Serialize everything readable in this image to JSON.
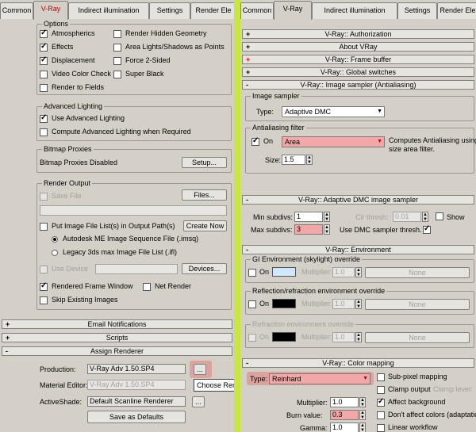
{
  "left": {
    "tabs": [
      "Common",
      "V-Ray",
      "Indirect illumination",
      "Settings",
      "Render Ele"
    ],
    "options_title": "Options",
    "options": [
      {
        "label": "Atmospherics",
        "checked": true
      },
      {
        "label": "Effects",
        "checked": true
      },
      {
        "label": "Displacement",
        "checked": true
      },
      {
        "label": "Video Color Check",
        "checked": false
      },
      {
        "label": "Render to Fields",
        "checked": false
      },
      {
        "label": "Render Hidden Geometry",
        "checked": false
      },
      {
        "label": "Area Lights/Shadows as Points",
        "checked": false
      },
      {
        "label": "Force 2-Sided",
        "checked": false
      },
      {
        "label": "Super Black",
        "checked": false
      }
    ],
    "advanced_lighting": {
      "title": "Advanced Lighting",
      "use": "Use Advanced Lighting",
      "compute": "Compute Advanced Lighting when Required"
    },
    "bitmap_proxies": {
      "title": "Bitmap Proxies",
      "status": "Bitmap Proxies Disabled",
      "setup": "Setup..."
    },
    "render_output": {
      "title": "Render Output",
      "save_file": "Save File",
      "files": "Files...",
      "put_image": "Put Image File List(s) in Output Path(s)",
      "create_now": "Create Now",
      "radio1": "Autodesk ME Image Sequence File (.imsq)",
      "radio2": "Legacy 3ds max Image File List (.ifl)",
      "use_device": "Use Device",
      "devices": "Devices...",
      "rendered_frame": "Rendered Frame Window",
      "net_render": "Net Render",
      "skip_existing": "Skip Existing Images"
    },
    "rollouts": [
      "Email Notifications",
      "Scripts",
      "Assign Renderer"
    ],
    "assign": {
      "production_label": "Production:",
      "production_value": "V-Ray Adv 1.50.SP4",
      "material_label": "Material Editor:",
      "material_value": "V-Ray Adv 1.50.SP4",
      "activeshade_label": "ActiveShade:",
      "activeshade_value": "Default Scanline Renderer",
      "choose_tip": "Choose Ren",
      "save_defaults": "Save as Defaults",
      "ellipsis": "..."
    }
  },
  "right": {
    "tabs": [
      "Common",
      "V-Ray",
      "Indirect illumination",
      "Settings",
      "Render Ele"
    ],
    "rollouts": [
      "V-Ray:: Authorization",
      "About VRay",
      "V-Ray:: Frame buffer",
      "V-Ray:: Global switches",
      "V-Ray:: Image sampler (Antialiasing)"
    ],
    "image_sampler": {
      "title": "Image sampler",
      "type_label": "Type:",
      "type_value": "Adaptive DMC"
    },
    "aa_filter": {
      "title": "Antialiasing filter",
      "on_label": "On",
      "filter_value": "Area",
      "desc1": "Computes Antialiasing using",
      "desc2": "size area filter.",
      "size_label": "Size:",
      "size_value": "1.5"
    },
    "dmc": {
      "title": "V-Ray:: Adaptive DMC image sampler",
      "min_label": "Min subdivs:",
      "min_value": "1",
      "max_label": "Max subdivs:",
      "max_value": "3",
      "clr_label": "Clr thresh:",
      "clr_value": "0.01",
      "show_label": "Show",
      "use_dmc": "Use DMC sampler thresh."
    },
    "environment": {
      "title": "V-Ray:: Environment",
      "gi_title": "GI Environment (skylight) override",
      "refl_title": "Reflection/refraction environment override",
      "refr_title": "Refraction environment override",
      "on": "On",
      "multiplier": "Multiplier:",
      "mult_value": "1.0",
      "none": "None",
      "gi_color": "#cfe6ff",
      "black": "#000000"
    },
    "color_mapping": {
      "title": "V-Ray:: Color mapping",
      "type_label": "Type:",
      "type_value": "Reinhard",
      "multiplier_label": "Multiplier:",
      "multiplier_value": "1.0",
      "burn_label": "Burn value:",
      "burn_value": "0.3",
      "gamma_label": "Gamma:",
      "gamma_value": "1.0",
      "subpixel": "Sub-pixel mapping",
      "clamp": "Clamp output",
      "clamp_level": "Clamp level:",
      "affect_bg": "Affect background",
      "dont_affect": "Don't affect colors (adaptatio",
      "linear": "Linear workflow"
    }
  },
  "colors": {
    "accent_divider": "#c8e63c",
    "highlight": "#f2a8a8",
    "tab_red": "#c00000"
  }
}
